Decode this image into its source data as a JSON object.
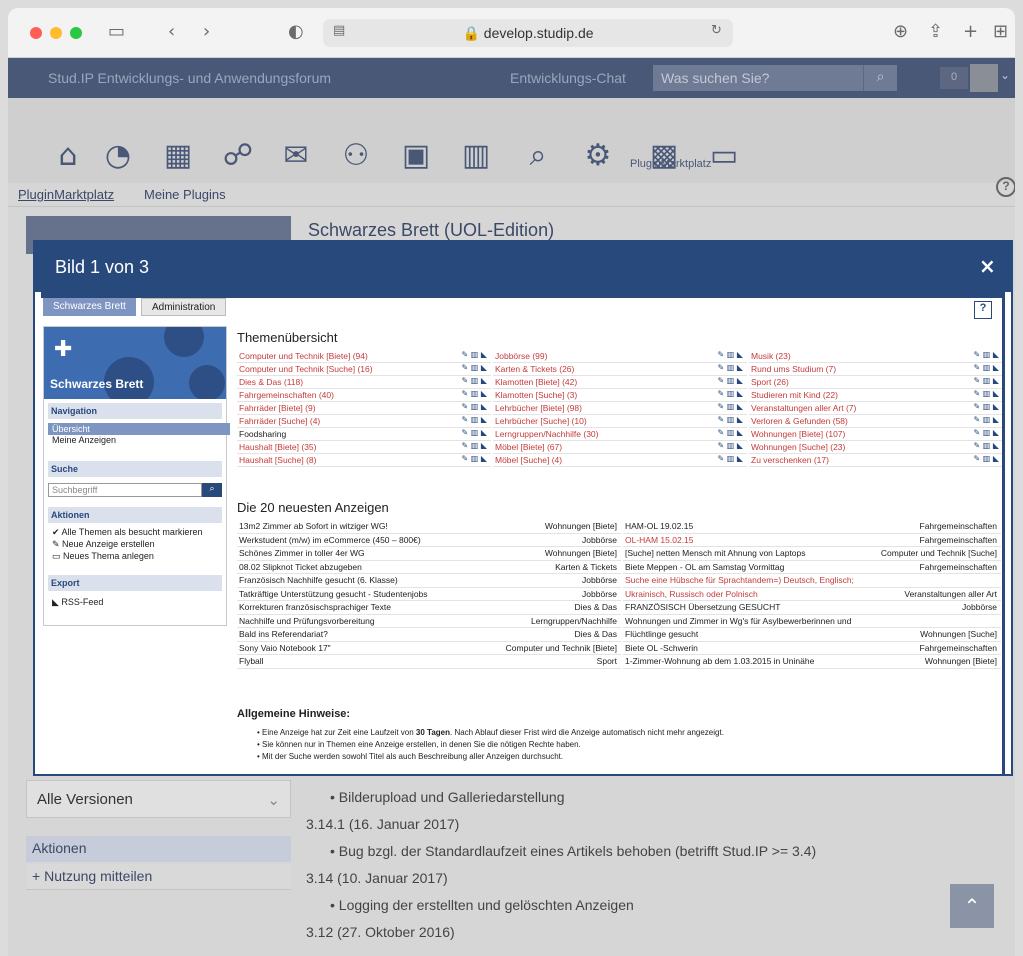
{
  "browser": {
    "url": "develop.studip.de"
  },
  "header": {
    "forum_title": "Stud.IP Entwicklungs- und Anwendungsforum",
    "chat": "Entwicklungs-Chat",
    "search_placeholder": "Was suchen Sie?",
    "counter": "0"
  },
  "iconbar": {
    "active_label": "PluginMarktplatz"
  },
  "subnav": {
    "items": [
      "PluginMarktplatz",
      "Meine Plugins"
    ]
  },
  "background": {
    "heading": "Schwarzes Brett (UOL-Edition)",
    "version_select": "Alle Versionen",
    "aktionen": "Aktionen",
    "nutzung": "Nutzung mitteilen",
    "changelog": [
      "Bilderupload und Galleriedarstellung",
      "3.14.1 (16. Januar 2017)",
      "Bug bzgl. der Standardlaufzeit eines Artikels behoben (betrifft Stud.IP >= 3.4)",
      "3.14 (10. Januar 2017)",
      "Logging der erstellten und gelöschten Anzeigen",
      "3.12 (27. Oktober 2016)"
    ]
  },
  "modal": {
    "title": "Bild 1 von 3",
    "close": "×"
  },
  "inner": {
    "tabs": [
      "Schwarzes Brett",
      "Administration"
    ],
    "sidebar": {
      "banner_title": "Schwarzes Brett",
      "navigation": "Navigation",
      "nav_items": [
        "Übersicht",
        "Meine Anzeigen"
      ],
      "suche": "Suche",
      "search_placeholder": "Suchbegriff",
      "aktionen": "Aktionen",
      "actions": [
        "Alle Themen als besucht markieren",
        "Neue Anzeige erstellen",
        "Neues Thema anlegen"
      ],
      "export": "Export",
      "rss": "RSS-Feed"
    },
    "topics_heading": "Themenübersicht",
    "topics": [
      [
        "Computer und Technik [Biete] (94)",
        "Computer und Technik [Suche] (16)",
        "Dies & Das (118)",
        "Fahrgemeinschaften (40)",
        "Fahrräder [Biete] (9)",
        "Fahrräder [Suche] (4)",
        "Foodsharing",
        "Haushalt [Biete] (35)",
        "Haushalt [Suche] (8)"
      ],
      [
        "Jobbörse (99)",
        "Karten & Tickets (26)",
        "Klamotten [Biete] (42)",
        "Klamotten [Suche] (3)",
        "Lehrbücher [Biete] (98)",
        "Lehrbücher [Suche] (10)",
        "Lerngruppen/Nachhilfe (30)",
        "Möbel [Biete] (67)",
        "Möbel [Suche] (4)"
      ],
      [
        "Musik (23)",
        "Rund ums Studium (7)",
        "Sport (26)",
        "Studieren mit Kind (22)",
        "Veranstaltungen aller Art (7)",
        "Verloren & Gefunden (58)",
        "Wohnungen [Biete] (107)",
        "Wohnungen [Suche] (23)",
        "Zu verschenken (17)"
      ]
    ],
    "ads_heading": "Die 20 neuesten Anzeigen",
    "ads_left": [
      [
        "13m2 Zimmer ab Sofort in witziger WG!",
        "Wohnungen [Biete]"
      ],
      [
        "Werkstudent (m/w) im eCommerce (450 – 800€)",
        "Jobbörse"
      ],
      [
        "Schönes Zimmer in toller 4er WG",
        "Wohnungen [Biete]"
      ],
      [
        "08.02 Slipknot Ticket abzugeben",
        "Karten & Tickets"
      ],
      [
        "Französisch Nachhilfe gesucht (6. Klasse)",
        "Jobbörse"
      ],
      [
        "Tatkräftige Unterstützung gesucht - Studentenjobs",
        "Jobbörse"
      ],
      [
        "Korrekturen französischsprachiger Texte",
        "Dies & Das"
      ],
      [
        "Nachhilfe und Prüfungsvorbereitung",
        "Lerngruppen/Nachhilfe"
      ],
      [
        "Bald ins Referendariat?",
        "Dies & Das"
      ],
      [
        "Sony Vaio Notebook 17\"",
        "Computer und Technik [Biete]"
      ],
      [
        "Flyball",
        "Sport"
      ]
    ],
    "ads_right": [
      [
        "HAM-OL 19.02.15",
        "Fahrgemeinschaften"
      ],
      [
        "OL-HAM 15.02.15",
        "Fahrgemeinschaften"
      ],
      [
        "[Suche] netten Mensch mit Ahnung von Laptops",
        "Computer und Technik [Suche]"
      ],
      [
        "Biete Meppen - OL am Samstag Vormittag",
        "Fahrgemeinschaften"
      ],
      [
        "Suche eine Hübsche für Sprachtandem=) Deutsch, Englisch;",
        ""
      ],
      [
        "Ukrainisch, Russisch oder Polnisch",
        "Veranstaltungen aller Art"
      ],
      [
        "FRANZÖSISCH Übersetzung GESUCHT",
        "Jobbörse"
      ],
      [
        "Wohnungen und Zimmer in Wg's für Asylbewerberinnen und",
        ""
      ],
      [
        "Flüchtlinge gesucht",
        "Wohnungen [Suche]"
      ],
      [
        "Biete OL -Schwerin",
        "Fahrgemeinschaften"
      ],
      [
        "1-Zimmer-Wohnung ab dem 1.03.2015 in Uninähe",
        "Wohnungen [Biete]"
      ]
    ],
    "hints_heading": "Allgemeine Hinweise:",
    "hint1_a": "Eine Anzeige hat zur Zeit eine Laufzeit von ",
    "hint1_b": "30 Tagen",
    "hint1_c": ". Nach Ablauf dieser Frist wird die Anzeige automatisch nicht mehr angezeigt.",
    "hint2": "Sie können nur in Themen eine Anzeige erstellen, in denen Sie die nötigen Rechte haben.",
    "hint3": "Mit der Suche werden sowohl Titel als auch Beschreibung aller Anzeigen durchsucht."
  }
}
